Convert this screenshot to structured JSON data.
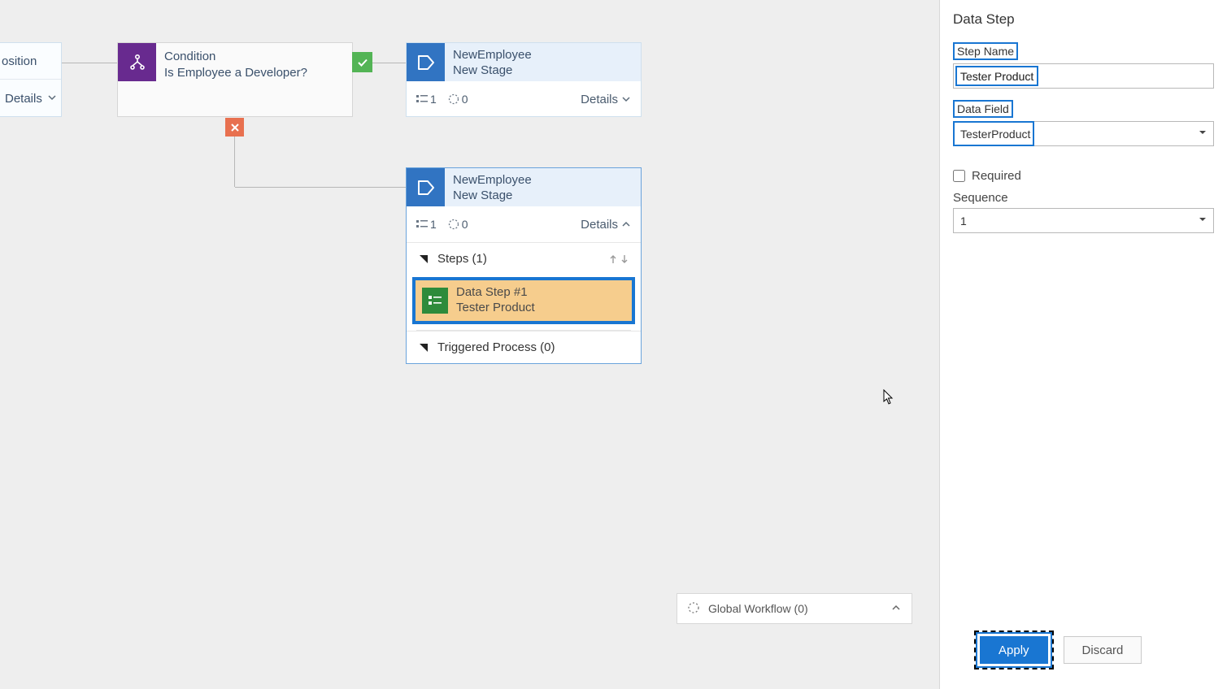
{
  "canvas": {
    "position_node": {
      "title": "osition",
      "details_label": "Details"
    },
    "condition_node": {
      "kind": "Condition",
      "question": "Is Employee a Developer?"
    },
    "stage_top": {
      "entity": "NewEmployee",
      "name": "New Stage",
      "count_steps": "1",
      "count_proc": "0",
      "details_label": "Details"
    },
    "stage_expanded": {
      "entity": "NewEmployee",
      "name": "New Stage",
      "count_steps": "1",
      "count_proc": "0",
      "details_label": "Details",
      "steps_header": "Steps (1)",
      "step": {
        "title": "Data Step #1",
        "subtitle": "Tester Product"
      },
      "triggered_header": "Triggered Process (0)"
    },
    "global_bar": "Global Workflow (0)"
  },
  "panel": {
    "title": "Data Step",
    "step_name_label": "Step Name",
    "step_name_value": "Tester Product",
    "data_field_label": "Data Field",
    "data_field_value": "TesterProduct",
    "required_label": "Required",
    "sequence_label": "Sequence",
    "sequence_value": "1",
    "apply_label": "Apply",
    "discard_label": "Discard"
  }
}
